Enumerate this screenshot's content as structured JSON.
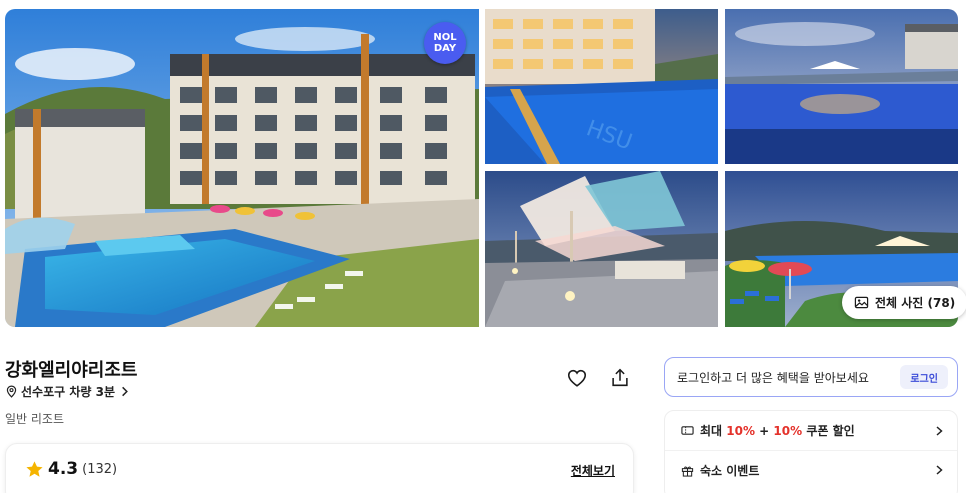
{
  "gallery": {
    "badge": {
      "line1": "NOL",
      "line2": "DAY"
    },
    "all_photos_label": "전체 사진 (78)",
    "photos": [
      "resort-building-pool",
      "pool-evening",
      "infinity-pool-dusk",
      "terrace-sail-canopy",
      "pool-parasols-night"
    ]
  },
  "hotel": {
    "name": "강화엘리야리조트",
    "location": "선수포구 차량 3분",
    "category": "일반 리조트"
  },
  "review": {
    "rating": "4.3",
    "count": "(132)",
    "view_all": "전체보기"
  },
  "login_banner": {
    "text": "로그인하고 더 많은 혜택을 받아보세요",
    "button": "로그인"
  },
  "benefits": {
    "coupon": {
      "prefix": "최대 ",
      "pct1": "10%",
      "plus": " + ",
      "pct2": "10%",
      "suffix": " 쿠폰 할인"
    },
    "event": {
      "label": "숙소 이벤트"
    }
  },
  "colors": {
    "accent": "#4a5cf0",
    "highlight": "#e4322b",
    "star": "#f5b400"
  }
}
